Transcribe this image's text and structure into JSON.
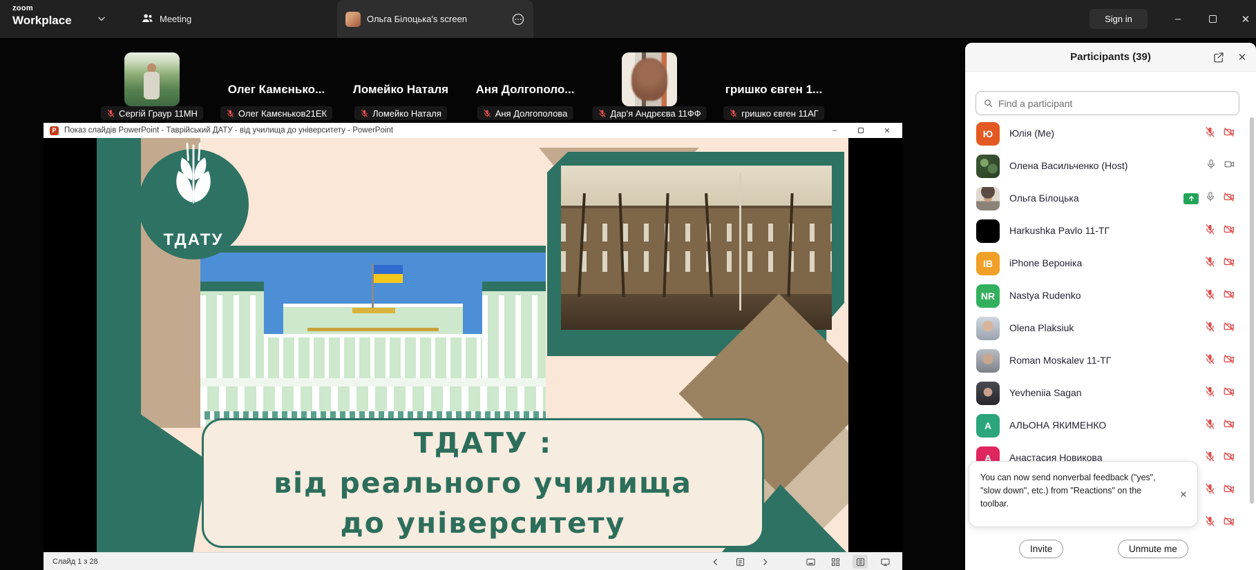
{
  "app": {
    "logo_top": "zoom",
    "logo_bottom": "Workplace",
    "tab_meeting": "Meeting",
    "tab_screen": "Ольга Білоцька's screen",
    "sign_in": "Sign in",
    "window_controls": {
      "minimize": "–",
      "close": "✕"
    }
  },
  "video_strip": {
    "tiles": [
      {
        "photo": "garden",
        "big_name": "",
        "label": "Сергій Граур 11МН"
      },
      {
        "photo": "",
        "big_name": "Олег Камєнько...",
        "label": "Олег Камєньков21ЕК"
      },
      {
        "photo": "",
        "big_name": "Ломейко Наталя",
        "label": "Ломейко Наталя"
      },
      {
        "photo": "",
        "big_name": "Аня  Долгополо...",
        "label": "Аня Долгополова"
      },
      {
        "photo": "doorway",
        "big_name": "",
        "label": "Дар'я Андрєєва 11ФФ"
      },
      {
        "photo": "",
        "big_name": "гришко євген 1...",
        "label": "гришко євген 11АГ"
      }
    ]
  },
  "powerpoint": {
    "icon_letter": "P",
    "title": "Показ слайдів PowerPoint  -  Таврійський ДАТУ - від училища до університету - PowerPoint",
    "minimize": "–",
    "close": "✕",
    "status": "Слайд 1 з 28",
    "slide": {
      "logo_text": "ТДАТУ",
      "title_line1": "ТДАТУ :",
      "title_line2": "від реального училища",
      "title_line3": "до університету"
    }
  },
  "participants_panel": {
    "title": "Participants (39)",
    "search_placeholder": "Find a participant",
    "rows": [
      {
        "name": "Юлія (Me)",
        "avatar": {
          "kind": "initials",
          "text": "Ю",
          "color": "#e25a22"
        },
        "mic": "muted",
        "video": "off",
        "share": false
      },
      {
        "name": "Олена Васильченко (Host)",
        "avatar": {
          "kind": "photo",
          "style": "foliage"
        },
        "mic": "on",
        "video": "on",
        "share": false
      },
      {
        "name": "Ольга Білоцька",
        "avatar": {
          "kind": "photo",
          "style": "olga"
        },
        "mic": "on",
        "video": "off",
        "share": true
      },
      {
        "name": "Harkushka Pavlo 11-ТГ",
        "avatar": {
          "kind": "solid",
          "color": "#000000"
        },
        "mic": "muted",
        "video": "off",
        "share": false
      },
      {
        "name": "iPhone Вероніка",
        "avatar": {
          "kind": "initials",
          "text": "IB",
          "color": "#f0a028"
        },
        "mic": "muted",
        "video": "off",
        "share": false
      },
      {
        "name": "Nastya Rudenko",
        "avatar": {
          "kind": "initials",
          "text": "NR",
          "color": "#33b05e"
        },
        "mic": "muted",
        "video": "off",
        "share": false
      },
      {
        "name": "Olena Plaksiuk",
        "avatar": {
          "kind": "photo",
          "style": "plaksiuk"
        },
        "mic": "muted",
        "video": "off",
        "share": false
      },
      {
        "name": "Roman Moskalev 11-ТГ",
        "avatar": {
          "kind": "photo",
          "style": "roman"
        },
        "mic": "muted",
        "video": "off",
        "share": false
      },
      {
        "name": "Yevheniia Sagan",
        "avatar": {
          "kind": "photo",
          "style": "sagan"
        },
        "mic": "muted",
        "video": "off",
        "share": false
      },
      {
        "name": "АЛЬОНА ЯКИМЕНКО",
        "avatar": {
          "kind": "initials",
          "text": "A",
          "color": "#2aa57c"
        },
        "mic": "muted",
        "video": "off",
        "share": false
      },
      {
        "name": "Анастасия Новикова",
        "avatar": {
          "kind": "initials",
          "text": "A",
          "color": "#e0265e"
        },
        "mic": "muted",
        "video": "off",
        "share": false
      },
      {
        "name": "",
        "avatar": {
          "kind": "none"
        },
        "mic": "muted",
        "video": "off",
        "share": false
      },
      {
        "name": "",
        "avatar": {
          "kind": "none"
        },
        "mic": "muted",
        "video": "off",
        "share": false
      }
    ],
    "toast": "You can now send nonverbal feedback (\"yes\", \"slow down\", etc.) from \"Reactions\" on the toolbar.",
    "toast_close": "✕",
    "invite": "Invite",
    "unmute": "Unmute me"
  },
  "colors": {
    "accent_red": "#e14d4d",
    "share_green": "#23a559",
    "slide_green": "#2e7263",
    "slide_cream": "#fae7d7"
  }
}
